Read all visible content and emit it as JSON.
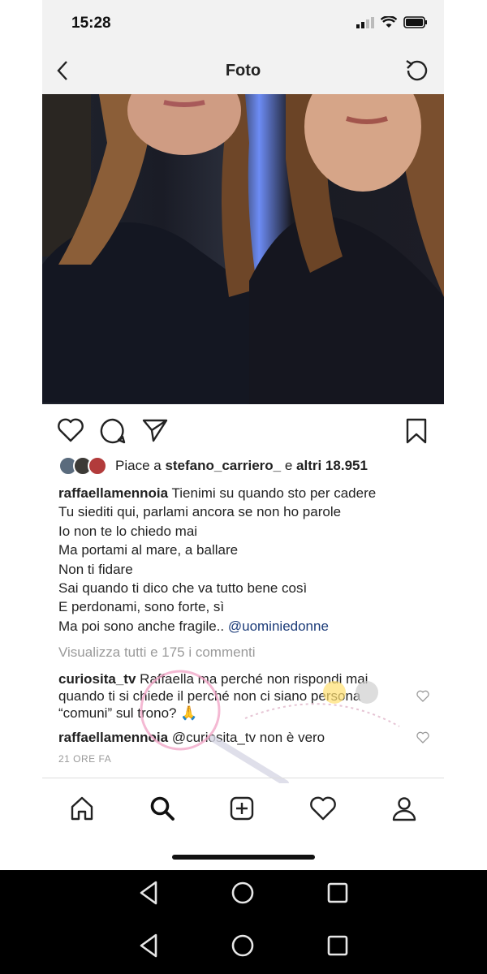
{
  "status_bar": {
    "time": "15:28"
  },
  "nav": {
    "title": "Foto"
  },
  "likes": {
    "prefix": "Piace a ",
    "user": "stefano_carriero_",
    "middle": " e ",
    "others": "altri 18.951"
  },
  "caption": {
    "username": "raffaellamennoia",
    "lines": [
      "Tienimi su quando sto per cadere",
      "Tu siediti qui, parlami ancora se non ho parole",
      "Io non te lo chiedo mai",
      "Ma portami al mare, a ballare",
      "Non ti fidare",
      "Sai quando ti dico che va tutto bene così",
      "E perdonami, sono forte, sì",
      "Ma poi sono anche fragile.."
    ],
    "mention": "@uominiedonne"
  },
  "view_all": "Visualizza tutti e 175 i commenti",
  "comments": [
    {
      "username": "curiosita_tv",
      "text": "Raffaella ma perché non rispondi mai quando ti si chiede il perché non ci siano persona “comuni” sul trono? 🙏"
    },
    {
      "username": "raffaellamennoia",
      "text": "@curiosita_tv non è vero"
    }
  ],
  "timestamp": "21 ORE FA",
  "colors": {
    "accent_link": "#1b3b78",
    "muted": "#9a9a9a"
  }
}
